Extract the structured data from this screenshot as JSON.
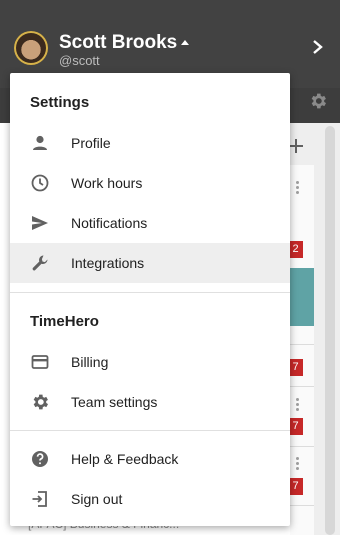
{
  "user": {
    "name": "Scott Brooks",
    "handle": "@scott"
  },
  "background": {
    "badges": [
      "2",
      "7",
      "7",
      "7"
    ],
    "partial_text": "[APAC] Business & Financ..."
  },
  "menu": {
    "settings_title": "Settings",
    "settings_items": [
      {
        "label": "Profile",
        "icon": "person-icon"
      },
      {
        "label": "Work hours",
        "icon": "clock-icon"
      },
      {
        "label": "Notifications",
        "icon": "send-icon"
      },
      {
        "label": "Integrations",
        "icon": "wrench-icon",
        "active": true
      }
    ],
    "team_title": "TimeHero",
    "team_items": [
      {
        "label": "Billing",
        "icon": "credit-card-icon"
      },
      {
        "label": "Team settings",
        "icon": "gear-icon"
      }
    ],
    "footer_items": [
      {
        "label": "Help & Feedback",
        "icon": "help-icon"
      },
      {
        "label": "Sign out",
        "icon": "sign-out-icon"
      }
    ]
  },
  "colors": {
    "topbar": "#424242",
    "active_row": "#eeeeee",
    "badge": "#c62828",
    "teal": "#5fa3a5"
  }
}
